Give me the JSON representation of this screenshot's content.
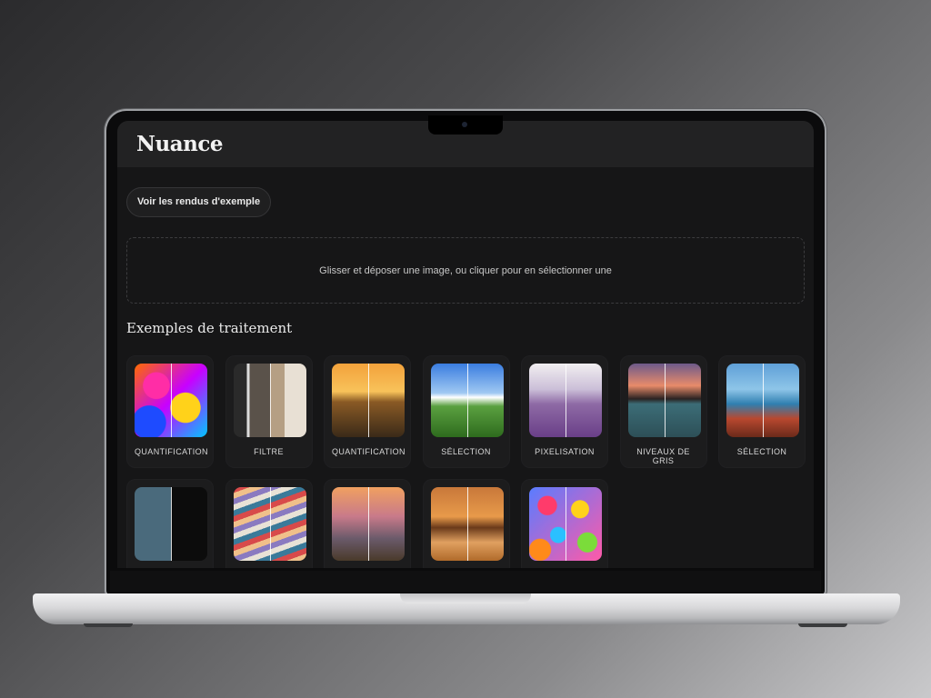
{
  "app": {
    "title": "Nuance"
  },
  "actions": {
    "examples_button": "Voir les rendus d'exemple"
  },
  "dropzone": {
    "text": "Glisser et déposer une image, ou cliquer pour en sélectionner une"
  },
  "examples": {
    "title": "Exemples de traitement",
    "items": [
      {
        "label": "QUANTIFICATION",
        "thumbnail": "abstract-paint"
      },
      {
        "label": "FILTRE",
        "thumbnail": "person-portrait"
      },
      {
        "label": "QUANTIFICATION",
        "thumbnail": "sunset-sea"
      },
      {
        "label": "SÉLECTION",
        "thumbnail": "green-hills"
      },
      {
        "label": "PIXELISATION",
        "thumbnail": "lavender-field"
      },
      {
        "label": "NIVEAUX DE GRIS",
        "thumbnail": "island-sunset"
      },
      {
        "label": "SÉLECTION",
        "thumbnail": "beach-food"
      },
      {
        "label": "",
        "thumbnail": "snowy-forest"
      },
      {
        "label": "",
        "thumbnail": "colorful-rocks"
      },
      {
        "label": "",
        "thumbnail": "stone-statues"
      },
      {
        "label": "",
        "thumbnail": "pyramids"
      },
      {
        "label": "",
        "thumbnail": "umbrellas"
      }
    ]
  },
  "colors": {
    "background": "#161617",
    "header": "#222223",
    "card": "#1c1c1d",
    "text": "#f2f2f2"
  }
}
